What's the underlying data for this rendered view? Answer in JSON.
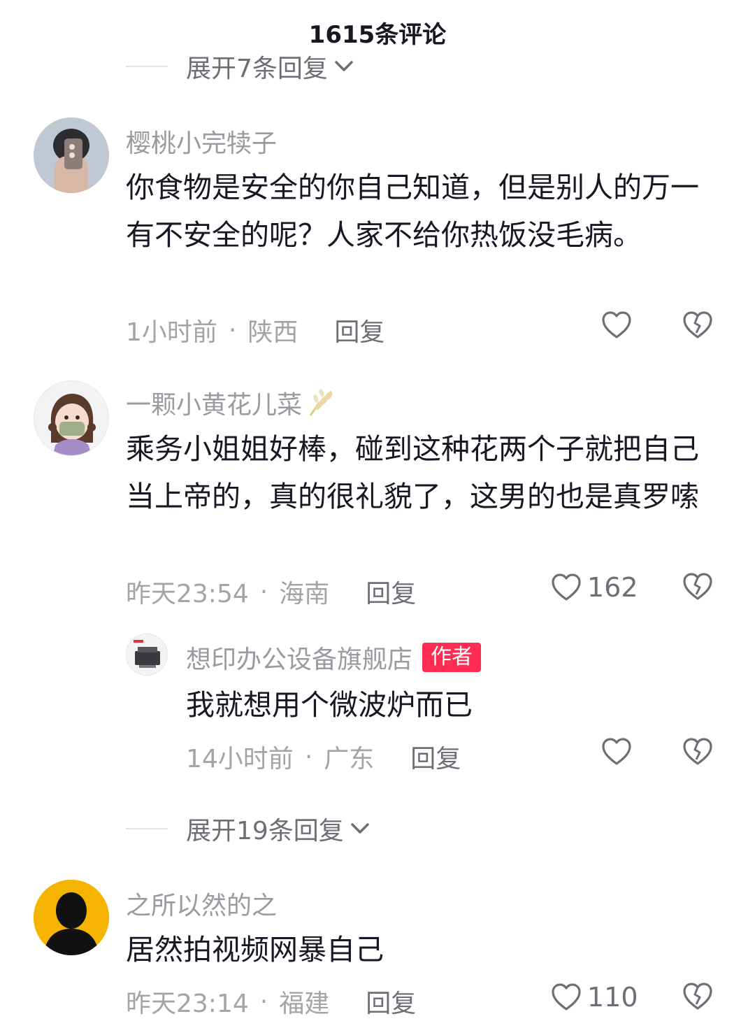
{
  "header": {
    "title": "1615条评论"
  },
  "expand_top": {
    "label": "展开7条回复"
  },
  "comments": [
    {
      "name": "樱桃小完犊子",
      "content": "你食物是安全的你自己知道，但是别人的万一有不安全的呢？人家不给你热饭没毛病。",
      "time": "1小时前",
      "location": "陕西",
      "reply_label": "回复",
      "like_count": ""
    },
    {
      "name": "一颗小黄花儿菜",
      "content": "乘务小姐姐好棒，碰到这种花两个子就把自己当上帝的，真的很礼貌了，这男的也是真罗嗦",
      "time": "昨天23:54",
      "location": "海南",
      "reply_label": "回复",
      "like_count": "162"
    },
    {
      "name": "之所以然的之",
      "content": "居然拍视频网暴自己",
      "time": "昨天23:14",
      "location": "福建",
      "reply_label": "回复",
      "like_count": "110"
    }
  ],
  "sub_reply": {
    "name": "想印办公设备旗舰店",
    "badge": "作者",
    "content": "我就想用个微波炉而已",
    "time": "14小时前",
    "location": "广东",
    "reply_label": "回复"
  },
  "expand_mid": {
    "label": "展开19条回复"
  },
  "separator": "·",
  "colors": {
    "accent": "#fe2c55",
    "muted_text": "#a3a4a8",
    "body_text": "#161823"
  },
  "icons": [
    "chevron-down-icon",
    "heart-icon",
    "broken-heart-icon",
    "wheat-icon"
  ]
}
